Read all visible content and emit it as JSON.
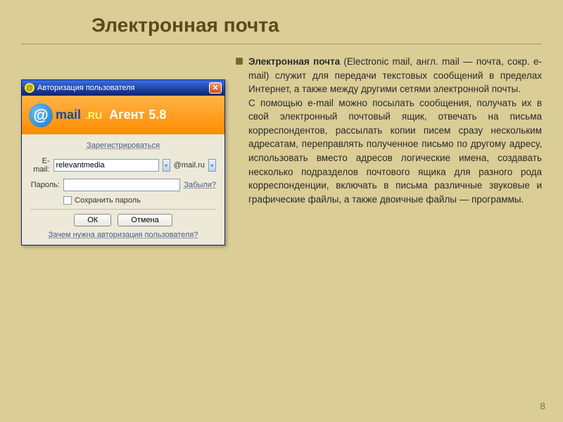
{
  "slide": {
    "title": "Электронная почта",
    "body_html": "<b>Электронная почта</b> (Electronic mail, англ. mail — почта, сокр. e-mail) служит для передачи текстовых сообщений в пределах Интернет, а также между другими сетями электронной почты.<br>С помощью e-mail можно посылать сообщения, получать их в свой электронный почтовый ящик, отвечать на письма корреспондентов, рассылать копии писем сразу нескольким адресатам, переправлять полученное письмо по другому адресу, использовать вместо адресов логические имена, создавать несколько подразделов почтового ящика для разного рода корреспонденции, включать в письма различные звуковые и графические файлы, а также двоичные файлы — программы.",
    "page_number": "8"
  },
  "dialog": {
    "title": "Авторизация пользователя",
    "brand_mail": "mail",
    "brand_ru": ".RU",
    "brand_agent": "Агент",
    "brand_version": "5.8",
    "register_link": "Зарегистрироваться",
    "email_label": "E-mail:",
    "email_value": "relevantmedia",
    "domain": "@mail.ru",
    "password_label": "Пароль:",
    "password_value": "",
    "forgot_link": "Забыли?",
    "save_password_label": "Сохранить пароль",
    "ok_button": "ОК",
    "cancel_button": "Отмена",
    "why_link": "Зачем нужна авторизация пользователя?"
  }
}
